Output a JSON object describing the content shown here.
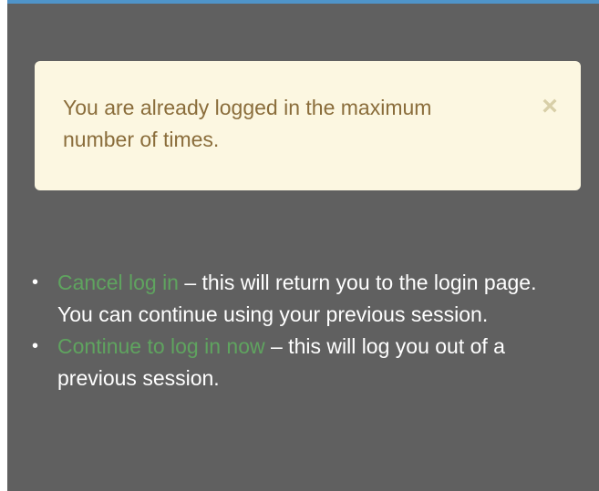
{
  "colors": {
    "background": "#606060",
    "top_accent": "#4f94c9",
    "alert_background": "#fcf7e1",
    "alert_text": "#8a6d3b",
    "link": "#5fa45f",
    "body_text": "#ffffff"
  },
  "alert": {
    "message": "You are already logged in the maximum number of times.",
    "close_icon": "close-icon",
    "close_glyph": "×"
  },
  "options": [
    {
      "link_label": "Cancel log in",
      "description": " – this will return you to the login page. You can continue using your previous session."
    },
    {
      "link_label": "Continue to log in now",
      "description": " – this will log you out of a previous session."
    }
  ]
}
